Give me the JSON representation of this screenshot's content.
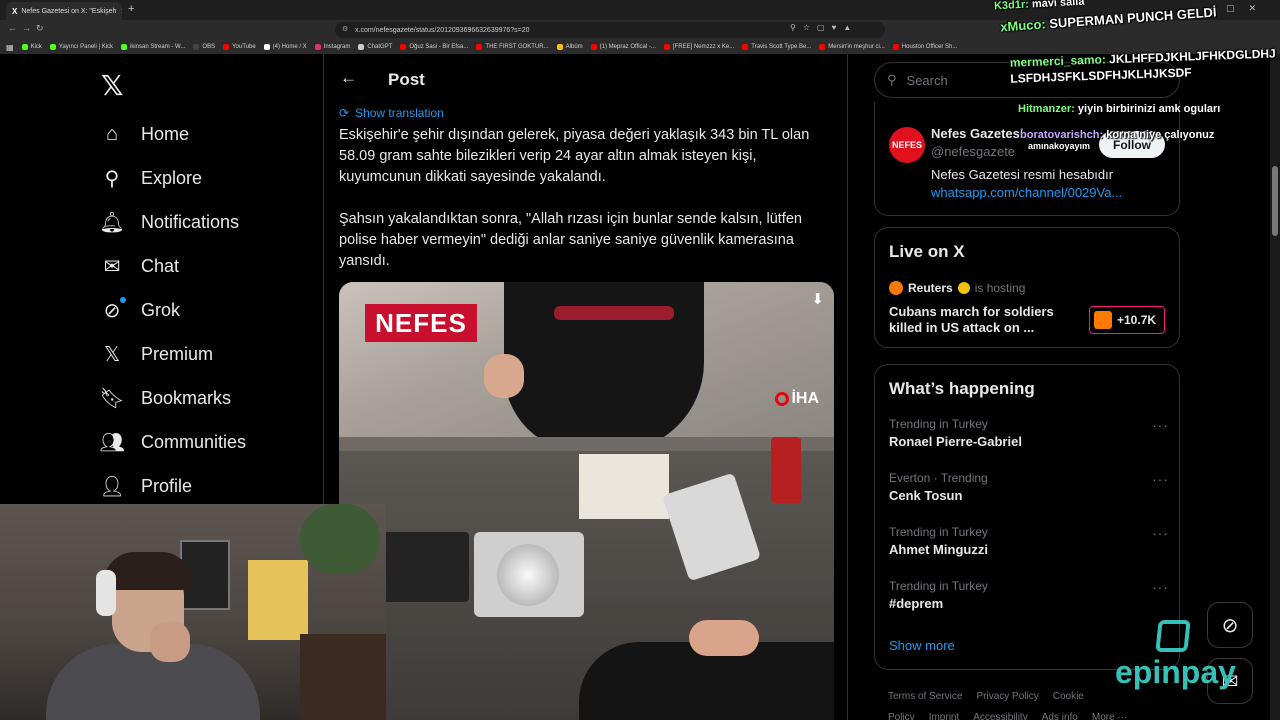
{
  "browser": {
    "tab_title": "Nefes Gazetesi on X: \"Eskişeh",
    "url": "x.com/nefesgazete/status/2012093696632639976?s=20",
    "bookmarks": [
      {
        "label": "Kick",
        "color": "#53fc18"
      },
      {
        "label": "Yayıncı Paneli | Kick",
        "color": "#53fc18"
      },
      {
        "label": "ikinsan Stream - W...",
        "color": "#53fc18"
      },
      {
        "label": "OBS",
        "color": "#444444"
      },
      {
        "label": "YouTube",
        "color": "#ff0000"
      },
      {
        "label": "(4) Home / X",
        "color": "#ffffff"
      },
      {
        "label": "Instagram",
        "color": "#e1306c"
      },
      {
        "label": "ChatGPT",
        "color": "#cccccc"
      },
      {
        "label": "Oğuz Sasi - Bir Efsa...",
        "color": "#ff0000"
      },
      {
        "label": "THE FIRST GOKTUR...",
        "color": "#ff0000"
      },
      {
        "label": "Albüm",
        "color": "#f4c20d"
      },
      {
        "label": "(1) Mepraz Offical -...",
        "color": "#ff0000"
      },
      {
        "label": "[FREE] Nemzzz x Ke...",
        "color": "#ff0000"
      },
      {
        "label": "Travis Scott Type Be...",
        "color": "#ff0000"
      },
      {
        "label": "Mersin'in meşhur ci...",
        "color": "#ff0000"
      },
      {
        "label": "Houston Officer Sh...",
        "color": "#ff0000"
      }
    ]
  },
  "nav": {
    "items": [
      {
        "label": "Home",
        "icon": "home-icon",
        "glyph": "⌂"
      },
      {
        "label": "Explore",
        "icon": "search-icon",
        "glyph": "⚲"
      },
      {
        "label": "Notifications",
        "icon": "bell-icon",
        "glyph": "🔔︎"
      },
      {
        "label": "Chat",
        "icon": "mail-icon",
        "glyph": "✉"
      },
      {
        "label": "Grok",
        "icon": "grok-icon",
        "glyph": "⊘"
      },
      {
        "label": "Premium",
        "icon": "x-premium-icon",
        "glyph": "𝕏"
      },
      {
        "label": "Bookmarks",
        "icon": "bookmark-icon",
        "glyph": "🔖︎"
      },
      {
        "label": "Communities",
        "icon": "communities-icon",
        "glyph": "👥︎"
      },
      {
        "label": "Profile",
        "icon": "person-icon",
        "glyph": "👤︎"
      }
    ]
  },
  "post": {
    "header": "Post",
    "show_translation": "Show translation",
    "paragraph1": "Eskişehir'e şehir dışından gelerek, piyasa değeri yaklaşık 343 bin TL olan 58.09 gram sahte bilezikleri verip 24 ayar altın almak isteyen kişi, kuyumcunun dikkati sayesinde yakalandı.",
    "paragraph2": "Şahsın yakalandıktan sonra, \"Allah rızası için bunlar sende kalsın, lütfen polise haber vermeyin\" dediği anlar saniye saniye güvenlik kamerasına yansıdı.",
    "media_brand": "NEFES",
    "media_agency": "İHA"
  },
  "sidebar": {
    "search_placeholder": "Search",
    "profile": {
      "avatar_text": "NEFES",
      "name": "Nefes Gazetesi",
      "handle": "@nefesgazete",
      "follow_label": "Follow",
      "bio": "Nefes Gazetesi resmi hesabıdır",
      "link": "whatsapp.com/channel/0029Va..."
    },
    "live": {
      "title": "Live on X",
      "host": "Reuters",
      "hosting": "is hosting",
      "stream_title": "Cubans march for soldiers killed in US attack on ...",
      "count": "+10.7K"
    },
    "happening": {
      "title": "What’s happening",
      "trends": [
        {
          "meta": "Trending in Turkey",
          "name": "Ronael Pierre-Gabriel"
        },
        {
          "meta": "Everton · Trending",
          "name": "Cenk Tosun"
        },
        {
          "meta": "Trending in Turkey",
          "name": "Ahmet Minguzzi"
        },
        {
          "meta": "Trending in Turkey",
          "name": "#deprem"
        }
      ],
      "show_more": "Show more"
    },
    "footer": {
      "links": [
        "Terms of Service",
        "Privacy Policy",
        "Cookie Policy",
        "Imprint",
        "Accessibility",
        "Ads info",
        "More ···"
      ]
    }
  },
  "stream_chat": [
    {
      "user": "K3d1r:",
      "msg": "mavi salla",
      "color": "green"
    },
    {
      "user": "xMuco:",
      "msg": "SUPERMAN PUNCH GELDİ",
      "color": "green"
    },
    {
      "user": "mermerci_samo:",
      "msg": "JKLHFFDJKHLJFHKDGLDHJ LSFDHJSFKLSDFHJKLHJKSDF",
      "color": "green"
    },
    {
      "user": "Hitmanzer:",
      "msg": "yiyin birbirinizi amk oguları",
      "color": "green"
    },
    {
      "user": "boratovarishch:",
      "msg": "korna niye çalıyonuz",
      "color": "purple"
    },
    {
      "user": "",
      "msg": "amınakoyayım",
      "color": "white"
    }
  ],
  "watermark": "epinpay",
  "colors": {
    "accent": "#1d9bf0",
    "brand_red": "#c8102e",
    "watermark": "#36c0b7"
  }
}
